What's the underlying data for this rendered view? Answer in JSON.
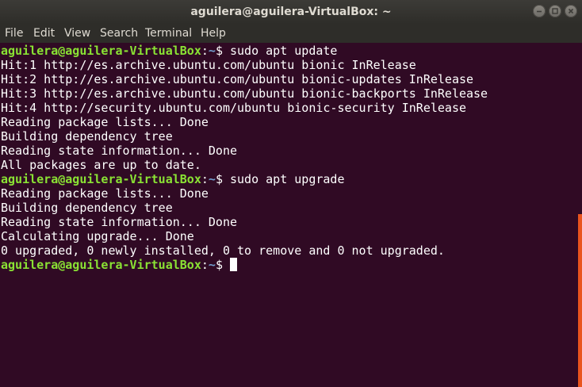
{
  "window": {
    "title": "aguilera@aguilera-VirtualBox: ~",
    "controls": [
      "minimize-icon",
      "maximize-icon",
      "close-icon"
    ]
  },
  "menu": [
    "File",
    "Edit",
    "View",
    "Search",
    "Terminal",
    "Help"
  ],
  "colors": {
    "background": "#300a24",
    "prompt_user": "#8ae234",
    "prompt_path": "#729fcf",
    "scrollbar": "#e9541e"
  },
  "prompt": {
    "user": "aguilera@aguilera-VirtualBox",
    "sep": ":",
    "path": "~",
    "symbol": "$ "
  },
  "lines": [
    {
      "type": "prompt",
      "command": "sudo apt update"
    },
    {
      "type": "output",
      "text": "Hit:1 http://es.archive.ubuntu.com/ubuntu bionic InRelease"
    },
    {
      "type": "output",
      "text": "Hit:2 http://es.archive.ubuntu.com/ubuntu bionic-updates InRelease"
    },
    {
      "type": "output",
      "text": "Hit:3 http://es.archive.ubuntu.com/ubuntu bionic-backports InRelease"
    },
    {
      "type": "output",
      "text": "Hit:4 http://security.ubuntu.com/ubuntu bionic-security InRelease"
    },
    {
      "type": "output",
      "text": "Reading package lists... Done"
    },
    {
      "type": "output",
      "text": "Building dependency tree"
    },
    {
      "type": "output",
      "text": "Reading state information... Done"
    },
    {
      "type": "output",
      "text": "All packages are up to date."
    },
    {
      "type": "prompt",
      "command": "sudo apt upgrade"
    },
    {
      "type": "output",
      "text": "Reading package lists... Done"
    },
    {
      "type": "output",
      "text": "Building dependency tree"
    },
    {
      "type": "output",
      "text": "Reading state information... Done"
    },
    {
      "type": "output",
      "text": "Calculating upgrade... Done"
    },
    {
      "type": "output",
      "text": "0 upgraded, 0 newly installed, 0 to remove and 0 not upgraded."
    },
    {
      "type": "prompt",
      "command": ""
    }
  ]
}
